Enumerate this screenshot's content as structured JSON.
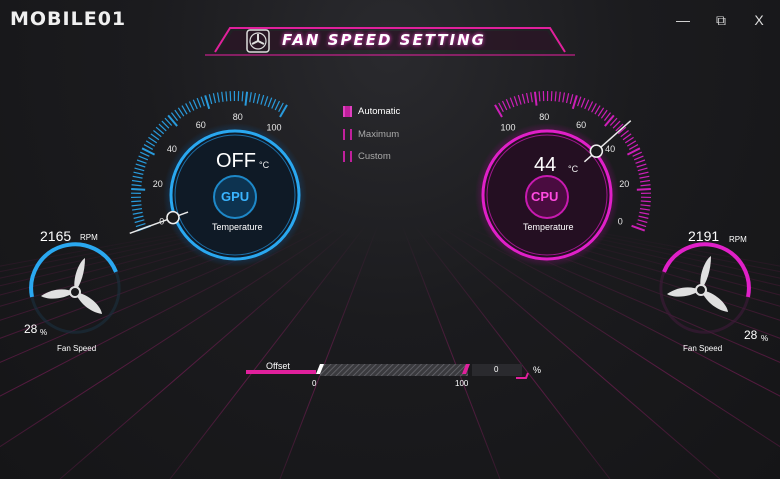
{
  "app": {
    "logo_text": "MOBILE01",
    "title": "FAN SPEED SETTING",
    "window_buttons": {
      "minimize": "—",
      "restore": "⧉",
      "close": "X"
    }
  },
  "modes": [
    {
      "label": "Automatic",
      "selected": true
    },
    {
      "label": "Maximum",
      "selected": false
    },
    {
      "label": "Custom",
      "selected": false
    }
  ],
  "gpu": {
    "chip_label": "GPU",
    "temperature_value": "OFF",
    "temperature_unit": "°C",
    "temperature_label": "Temperature",
    "scale_labels": [
      "0",
      "20",
      "40",
      "60",
      "80",
      "100"
    ],
    "fan_rpm": "2165",
    "rpm_unit": "RPM",
    "fan_percent": "28",
    "percent_unit": "%",
    "fan_speed_label": "Fan Speed",
    "needle_value": 0
  },
  "cpu": {
    "chip_label": "CPU",
    "temperature_value": "44",
    "temperature_unit": "°C",
    "temperature_label": "Temperature",
    "scale_labels": [
      "0",
      "20",
      "40",
      "60",
      "80",
      "100"
    ],
    "fan_rpm": "2191",
    "rpm_unit": "RPM",
    "fan_percent": "28",
    "percent_unit": "%",
    "fan_speed_label": "Fan Speed",
    "needle_value": 44
  },
  "offset": {
    "label": "Offset",
    "min_label": "0",
    "max_label": "100",
    "value": "0",
    "unit": "%"
  },
  "colors": {
    "gpu_accent": "#2aa8f0",
    "cpu_accent": "#e020c8",
    "magenta": "#e8209c"
  }
}
